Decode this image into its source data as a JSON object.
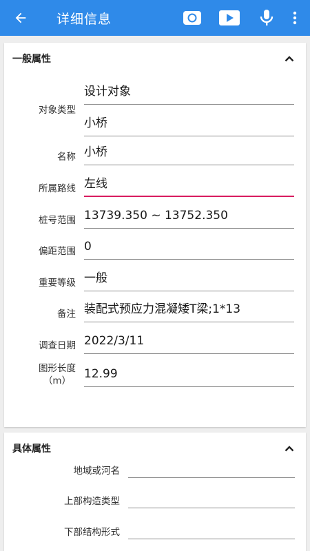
{
  "appbar": {
    "title": "详细信息",
    "icons": [
      "back-arrow-icon",
      "camera-icon",
      "video-icon",
      "mic-icon",
      "more-vert-icon"
    ]
  },
  "general": {
    "title": "一般属性",
    "fields": {
      "object_type_label": "对象类型",
      "object_type_value1": "设计对象",
      "object_type_value2": "小桥",
      "name_label": "名称",
      "name_value": "小桥",
      "route_label": "所属路线",
      "route_value": "左线",
      "station_label": "桩号范围",
      "station_value": "13739.350 ~ 13752.350",
      "offset_label": "偏距范围",
      "offset_value": "0",
      "importance_label": "重要等级",
      "importance_value": "一般",
      "remark_label": "备注",
      "remark_value": "装配式预应力混凝矮T梁;1*13",
      "survey_date_label": "调查日期",
      "survey_date_value": "2022/3/11",
      "length_label_line1": "图形长度",
      "length_label_line2": "（m）",
      "length_value": "12.99"
    }
  },
  "specific": {
    "title": "具体属性",
    "fields": {
      "region_label": "地域或河名",
      "upper_label": "上部构造类型",
      "lower_label": "下部结构形式"
    }
  },
  "colors": {
    "appbar": "#2f8ae9",
    "active_underline": "#d81b60"
  }
}
